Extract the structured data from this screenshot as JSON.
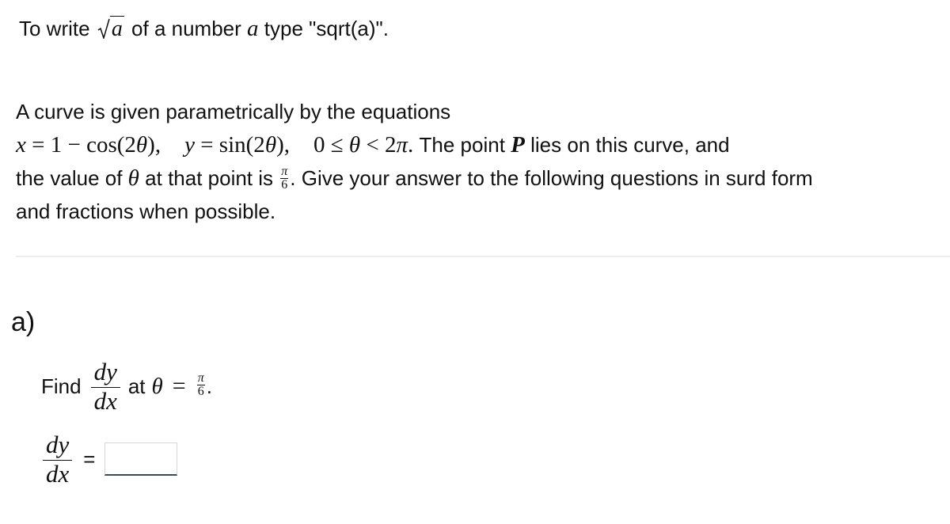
{
  "hint": {
    "prefix": "To write",
    "sqrt_symbol": "√",
    "sqrt_arg": "a",
    "middle": "of a number",
    "var": "a",
    "suffix": "type \"sqrt(a)\"."
  },
  "problem": {
    "line1": "A curve is given parametrically by the equations",
    "eq_x": "x = 1 − cos(2θ),",
    "eq_y": "y = sin(2θ),",
    "domain": "0 ≤ θ < 2π.",
    "line2_text_a": "The point",
    "point": "P",
    "line2_text_b": "lies on this curve, and",
    "line3_a": "the value of",
    "theta": "θ",
    "line3_b": "at that point is",
    "theta_value_num": "π",
    "theta_value_den": "6",
    "line3_c": ". Give your answer to the following questions in surd form",
    "line4": "and fractions when possible."
  },
  "part_a": {
    "label": "a)",
    "find": "Find",
    "deriv_num": "dy",
    "deriv_den": "dx",
    "at": "at",
    "theta": "θ",
    "equals": "=",
    "value_num": "π",
    "value_den": "6",
    "period": ".",
    "answer_num": "dy",
    "answer_den": "dx",
    "answer_equals": "=",
    "answer_value": ""
  }
}
